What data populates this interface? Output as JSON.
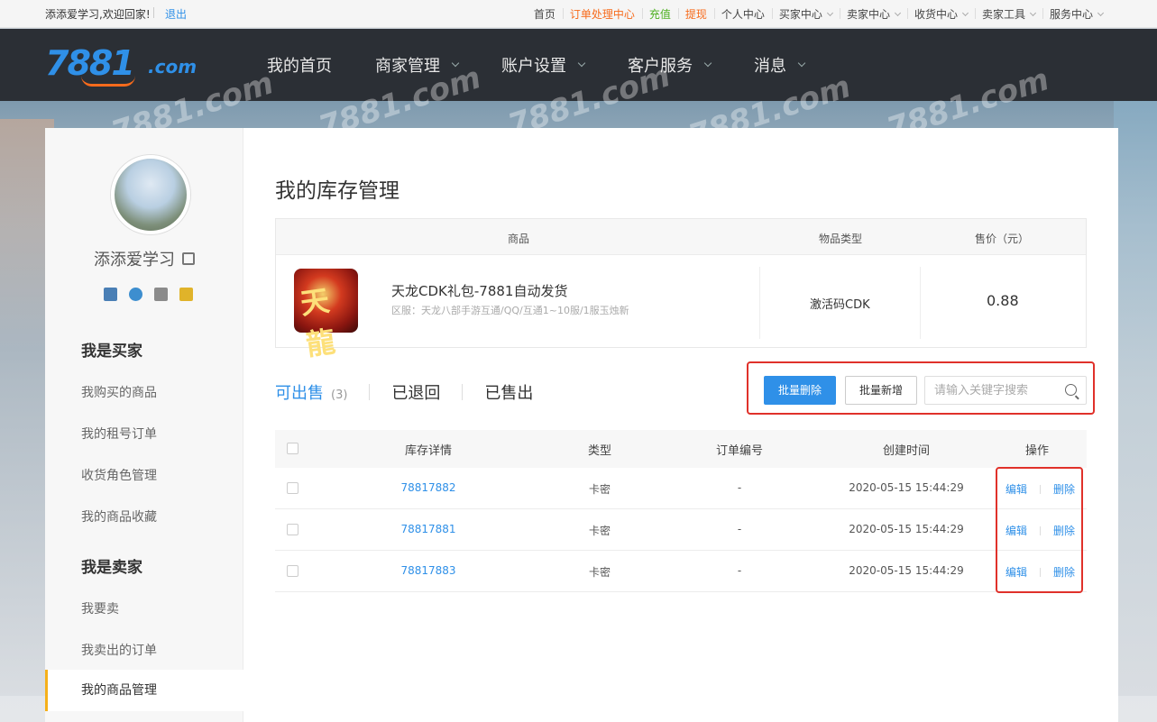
{
  "topbar": {
    "welcome": "添添爱学习,欢迎回家!",
    "logout": "退出",
    "links": [
      {
        "label": "首页",
        "color": ""
      },
      {
        "label": "订单处理中心",
        "color": "orange"
      },
      {
        "label": "充值",
        "color": "green"
      },
      {
        "label": "提现",
        "color": "orange"
      },
      {
        "label": "个人中心",
        "color": ""
      },
      {
        "label": "买家中心",
        "color": "",
        "dropdown": true
      },
      {
        "label": "卖家中心",
        "color": "",
        "dropdown": true
      },
      {
        "label": "收货中心",
        "color": "",
        "dropdown": true
      },
      {
        "label": "卖家工具",
        "color": "",
        "dropdown": true
      },
      {
        "label": "服务中心",
        "color": "",
        "dropdown": true
      }
    ]
  },
  "header": {
    "logo_num": "7881",
    "logo_com": ".com",
    "watermark": "7881.com",
    "nav": [
      {
        "label": "我的首页",
        "dropdown": false
      },
      {
        "label": "商家管理",
        "dropdown": true
      },
      {
        "label": "账户设置",
        "dropdown": true
      },
      {
        "label": "客户服务",
        "dropdown": true
      },
      {
        "label": "消息",
        "dropdown": true
      }
    ]
  },
  "sidebar": {
    "username": "添添爱学习",
    "buyer_title": "我是买家",
    "buyer_items": [
      "我购买的商品",
      "我的租号订单",
      "收货角色管理",
      "我的商品收藏"
    ],
    "seller_title": "我是卖家",
    "seller_items": [
      "我要卖",
      "我卖出的订单",
      "我的商品管理"
    ],
    "active_item": "我的商品管理"
  },
  "main": {
    "title": "我的库存管理",
    "goods_header": {
      "product": "商品",
      "type": "物品类型",
      "price": "售价（元）"
    },
    "goods": {
      "thumb_text": "天龍",
      "name": "天龙CDK礼包-7881自动发货",
      "region": "区服：天龙八部手游互通/QQ/互通1~10服/1服玉烛新",
      "type": "激活码CDK",
      "price": "0.88"
    },
    "tabs": [
      {
        "label": "可出售",
        "count": "(3)",
        "active": true
      },
      {
        "label": "已退回",
        "count": "",
        "active": false
      },
      {
        "label": "已售出",
        "count": "",
        "active": false
      }
    ],
    "batch_delete": "批量删除",
    "batch_add": "批量新增",
    "search_placeholder": "请输入关键字搜索",
    "table": {
      "headers": [
        "库存详情",
        "类型",
        "订单编号",
        "创建时间",
        "操作"
      ],
      "rows": [
        {
          "id": "78817882",
          "type": "卡密",
          "order": "-",
          "created": "2020-05-15 15:44:29",
          "edit": "编辑",
          "delete": "删除"
        },
        {
          "id": "78817881",
          "type": "卡密",
          "order": "-",
          "created": "2020-05-15 15:44:29",
          "edit": "编辑",
          "delete": "删除"
        },
        {
          "id": "78817883",
          "type": "卡密",
          "order": "-",
          "created": "2020-05-15 15:44:29",
          "edit": "编辑",
          "delete": "删除"
        }
      ]
    }
  },
  "colors": {
    "accent": "#2f90e8",
    "highlight": "#e0312a",
    "orange": "#f76b1c",
    "active_bar": "#f5b01a"
  }
}
